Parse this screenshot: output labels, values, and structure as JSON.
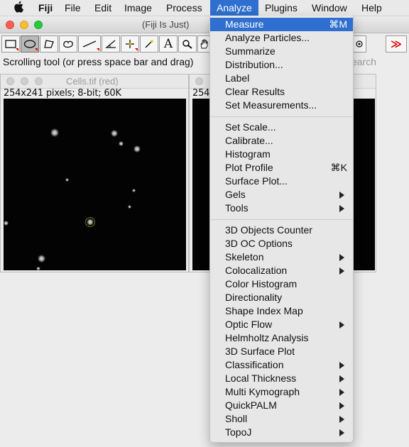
{
  "menubar": {
    "app_name": "Fiji",
    "menus": [
      "File",
      "Edit",
      "Image",
      "Process",
      "Analyze",
      "Plugins",
      "Window",
      "Help"
    ]
  },
  "main_window": {
    "title": "(Fiji Is Just)",
    "status": "Scrolling tool (or press space bar and drag)",
    "search_hint": "search",
    "tools": [
      "rectangle-tool",
      "oval-tool",
      "polygon-tool",
      "freehand-tool",
      "line-tool",
      "angle-tool",
      "point-tool",
      "wand-tool",
      "text-tool",
      "zoom-tool",
      "scroll-tool",
      "more-tools"
    ],
    "text_tool_glyph": "A",
    "more_tools_glyph": "≫"
  },
  "image_windows": [
    {
      "title": "Cells.tif (red)",
      "info": "254x241 pixels; 8-bit; 60K"
    },
    {
      "title": "",
      "info": "254"
    }
  ],
  "analyze_menu": {
    "group1": [
      {
        "label": "Measure",
        "shortcut": "⌘M",
        "highlighted": true
      },
      {
        "label": "Analyze Particles..."
      },
      {
        "label": "Summarize"
      },
      {
        "label": "Distribution..."
      },
      {
        "label": "Label"
      },
      {
        "label": "Clear Results"
      },
      {
        "label": "Set Measurements..."
      }
    ],
    "group2": [
      {
        "label": "Set Scale..."
      },
      {
        "label": "Calibrate..."
      },
      {
        "label": "Histogram"
      },
      {
        "label": "Plot Profile",
        "shortcut": "⌘K"
      },
      {
        "label": "Surface Plot..."
      },
      {
        "label": "Gels",
        "submenu": true
      },
      {
        "label": "Tools",
        "submenu": true
      }
    ],
    "group3": [
      {
        "label": "3D Objects Counter"
      },
      {
        "label": "3D OC Options"
      },
      {
        "label": "Skeleton",
        "submenu": true
      },
      {
        "label": "Colocalization",
        "submenu": true
      },
      {
        "label": "Color Histogram"
      },
      {
        "label": "Directionality"
      },
      {
        "label": "Shape Index Map"
      },
      {
        "label": "Optic Flow",
        "submenu": true
      },
      {
        "label": "Helmholtz Analysis"
      },
      {
        "label": "3D Surface Plot"
      },
      {
        "label": "Classification",
        "submenu": true
      },
      {
        "label": "Local Thickness",
        "submenu": true
      },
      {
        "label": "Multi Kymograph",
        "submenu": true
      },
      {
        "label": "QuickPALM",
        "submenu": true
      },
      {
        "label": "Sholl",
        "submenu": true
      },
      {
        "label": "TopoJ",
        "submenu": true
      }
    ]
  },
  "colors": {
    "menu_highlight": "#2f6fcf",
    "tool_overflow_red": "#dd0000"
  }
}
